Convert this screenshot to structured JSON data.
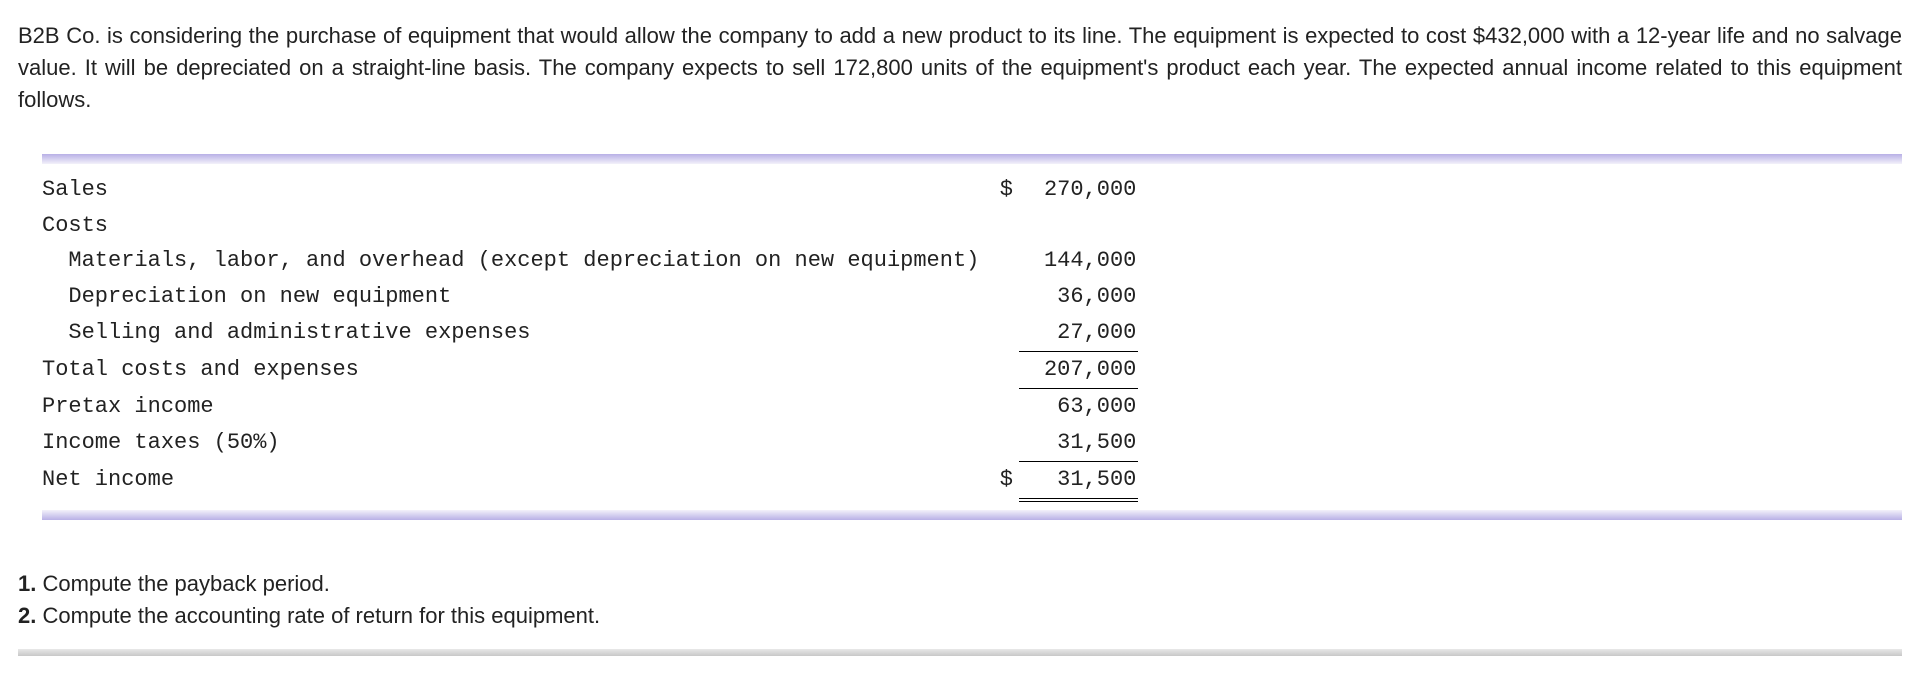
{
  "intro": "B2B Co. is considering the purchase of equipment that would allow the company to add a new product to its line. The equipment is expected to cost $432,000 with a 12-year life and no salvage value. It will be depreciated on a straight-line basis. The company expects to sell 172,800 units of the equipment's product each year. The expected annual income related to this equipment follows.",
  "rows": {
    "sales": {
      "label": "Sales",
      "cur": "$",
      "val": "270,000"
    },
    "costs_hdr": {
      "label": "Costs",
      "cur": "",
      "val": ""
    },
    "materials": {
      "label": "  Materials, labor, and overhead (except depreciation on new equipment)",
      "cur": "",
      "val": "144,000"
    },
    "depreciation": {
      "label": "  Depreciation on new equipment",
      "cur": "",
      "val": "36,000"
    },
    "selling": {
      "label": "  Selling and administrative expenses",
      "cur": "",
      "val": "27,000"
    },
    "total_costs": {
      "label": "Total costs and expenses",
      "cur": "",
      "val": "207,000"
    },
    "pretax": {
      "label": "Pretax income",
      "cur": "",
      "val": "63,000"
    },
    "taxes": {
      "label": "Income taxes (50%)",
      "cur": "",
      "val": "31,500"
    },
    "net": {
      "label": "Net income",
      "cur": "$",
      "val": "31,500"
    }
  },
  "q1": {
    "num": "1.",
    "text": " Compute the payback period."
  },
  "q2": {
    "num": "2.",
    "text": " Compute the accounting rate of return for this equipment."
  }
}
